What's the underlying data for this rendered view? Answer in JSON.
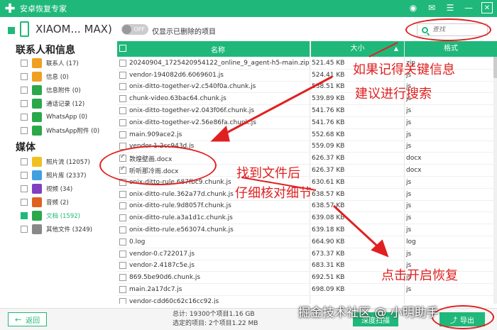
{
  "titlebar": {
    "title": "安卓恢复专家",
    "icons": [
      "wifi-icon",
      "chat-icon",
      "menu-icon",
      "minimize-icon",
      "close-icon"
    ]
  },
  "device": {
    "name": "XIAOM... MAX)",
    "toggle_state": "OFF",
    "toggle_label": "仅显示已删除的项目",
    "search_placeholder": "查找"
  },
  "sidebar": {
    "section_contacts": "联系人和信息",
    "contacts_items": [
      {
        "label": "联系人 (17)",
        "icon": "contacts-icon",
        "color": "#f0a020"
      },
      {
        "label": "信息 (0)",
        "icon": "message-icon",
        "color": "#f0a020"
      },
      {
        "label": "信息附件 (0)",
        "icon": "attachment-icon",
        "color": "#2aa84a"
      },
      {
        "label": "通话记录 (12)",
        "icon": "call-log-icon",
        "color": "#2aa84a"
      },
      {
        "label": "WhatsApp (0)",
        "icon": "whatsapp-icon",
        "color": "#2aa84a"
      },
      {
        "label": "WhatsApp附件 (0)",
        "icon": "whatsapp-attachment-icon",
        "color": "#2aa84a"
      }
    ],
    "section_media": "媒体",
    "media_items": [
      {
        "label": "照片流 (12057)",
        "icon": "photo-stream-icon",
        "color": "#f0c020"
      },
      {
        "label": "照片库 (2337)",
        "icon": "photo-library-icon",
        "color": "#40a0e0"
      },
      {
        "label": "视频 (34)",
        "icon": "video-icon",
        "color": "#8040c0"
      },
      {
        "label": "音频 (2)",
        "icon": "audio-icon",
        "color": "#e06020"
      },
      {
        "label": "文档 (1592)",
        "icon": "document-icon",
        "color": "#2aa84a",
        "active": true
      },
      {
        "label": "其他文件 (3249)",
        "icon": "other-files-icon",
        "color": "#888888"
      }
    ]
  },
  "table": {
    "headers": {
      "name": "名称",
      "size": "大小",
      "format": "格式"
    },
    "rows": [
      {
        "name": "20240904_1725420954122_online_9_agent-h5-main.zip",
        "size": "521.45 KB",
        "format": "zip",
        "checked": false
      },
      {
        "name": "vendor-194082d6.6069601.js",
        "size": "524.41 KB",
        "format": "js",
        "checked": false
      },
      {
        "name": "onix-ditto-together-v2.c540f0a.chunk.js",
        "size": "538.51 KB",
        "format": "js",
        "checked": false
      },
      {
        "name": "chunk-video.63bac64.chunk.js",
        "size": "539.89 KB",
        "format": "js",
        "checked": false
      },
      {
        "name": "onix-ditto-together-v2.043f06f.chunk.js",
        "size": "541.76 KB",
        "format": "js",
        "checked": false
      },
      {
        "name": "onix-ditto-together-v2.56e86fa.chunk.js",
        "size": "541.76 KB",
        "format": "js",
        "checked": false
      },
      {
        "name": "main.909ace2.js",
        "size": "552.68 KB",
        "format": "js",
        "checked": false
      },
      {
        "name": "vendor-1.2cc943d.js",
        "size": "559.09 KB",
        "format": "js",
        "checked": false
      },
      {
        "name": "敦煌壁画.docx",
        "size": "626.37 KB",
        "format": "docx",
        "checked": true
      },
      {
        "name": "听听那冷雨.docx",
        "size": "626.37 KB",
        "format": "docx",
        "checked": true
      },
      {
        "name": "onix-ditto-rule.687fbc9.chunk.js",
        "size": "630.61 KB",
        "format": "js",
        "checked": false
      },
      {
        "name": "onix-ditto-rule.362a77d.chunk.js",
        "size": "638.57 KB",
        "format": "js",
        "checked": false
      },
      {
        "name": "onix-ditto-rule.9d8057f.chunk.js",
        "size": "638.57 KB",
        "format": "js",
        "checked": false
      },
      {
        "name": "onix-ditto-rule.a3a1d1c.chunk.js",
        "size": "639.08 KB",
        "format": "js",
        "checked": false
      },
      {
        "name": "onix-ditto-rule.e563074.chunk.js",
        "size": "639.18 KB",
        "format": "js",
        "checked": false
      },
      {
        "name": "0.log",
        "size": "664.90 KB",
        "format": "log",
        "checked": false
      },
      {
        "name": "vendor-0.c722017.js",
        "size": "673.37 KB",
        "format": "js",
        "checked": false
      },
      {
        "name": "vendor-2.4187c5e.js",
        "size": "683.31 KB",
        "format": "js",
        "checked": false
      },
      {
        "name": "869.5be90d6.chunk.js",
        "size": "692.51 KB",
        "format": "js",
        "checked": false
      },
      {
        "name": "main.2a17dc7.js",
        "size": "698.09 KB",
        "format": "js",
        "checked": false
      },
      {
        "name": "vendor-cdd60c62c16cc92.js",
        "size": "",
        "format": "",
        "checked": false
      }
    ]
  },
  "bottom": {
    "back_label": "返回",
    "total_line": "总计: 19300个项目1.16 GB",
    "selected_line": "选定的项目: 2个项目1.22 MB",
    "scan_label": "深度扫描",
    "export_label": "导出"
  },
  "annotations": {
    "search_tip_1": "如果记得关键信息",
    "search_tip_2": "建议进行搜索",
    "find_tip_1": "找到文件后",
    "find_tip_2": "仔细核对细节",
    "restore_tip": "点击开启恢复",
    "watermark": "掘金技术社区 @ 小明助手"
  },
  "colors": {
    "accent": "#1fb87a",
    "annotation": "#e02020"
  }
}
